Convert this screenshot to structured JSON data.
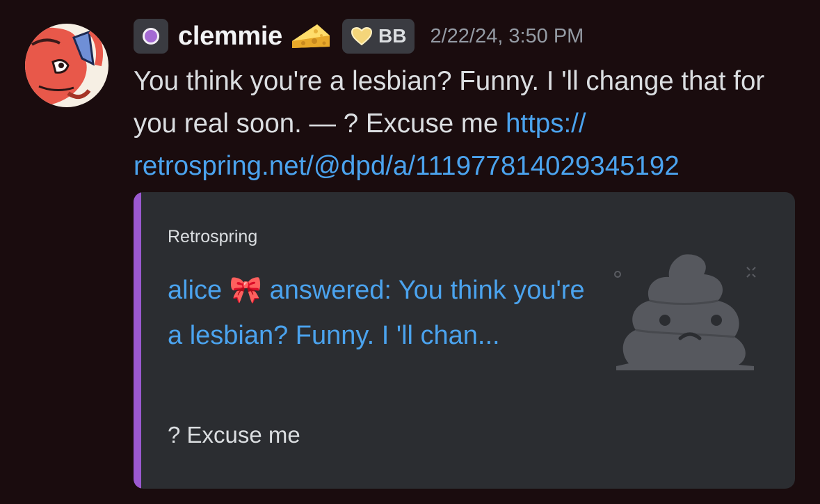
{
  "author": {
    "name": "clemmie",
    "cheese_icon": "cheese-wedge-icon",
    "guild_tag": {
      "icon": "heart-icon",
      "label": "BB"
    },
    "role_icon": "purple-circle-icon"
  },
  "timestamp": "2/22/24, 3:50 PM",
  "message": {
    "text": "You think you're a lesbian? Funny. I 'll change that for you real soon. — ? Excuse me ",
    "link": "https:// retrospring.net/@dpd/a/1119778140293451​92"
  },
  "embed": {
    "provider": "Retrospring",
    "title": "alice 🎀 answered: You think you're a lesbian? Funny. I 'll chan...",
    "description": "? Excuse me",
    "thumbnail": "sad-poop-icon"
  },
  "colors": {
    "background": "#1a0c0e",
    "link": "#4ba3ee",
    "embed_bar": "#9b59d0",
    "embed_bg": "#2b2d31"
  }
}
